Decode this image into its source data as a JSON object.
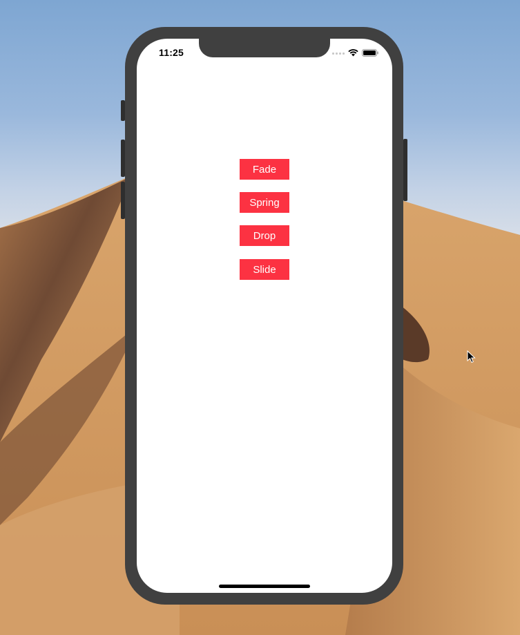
{
  "status_bar": {
    "time": "11:25",
    "icons": [
      "signal-dots-icon",
      "wifi-icon",
      "battery-icon"
    ]
  },
  "buttons": [
    {
      "label": "Fade"
    },
    {
      "label": "Spring"
    },
    {
      "label": "Drop"
    },
    {
      "label": "Slide"
    }
  ],
  "colors": {
    "button_background": "#fc3242",
    "button_text": "#ffffff",
    "phone_frame": "#404040",
    "screen_background": "#ffffff"
  },
  "cursor": "arrow-cursor-icon"
}
